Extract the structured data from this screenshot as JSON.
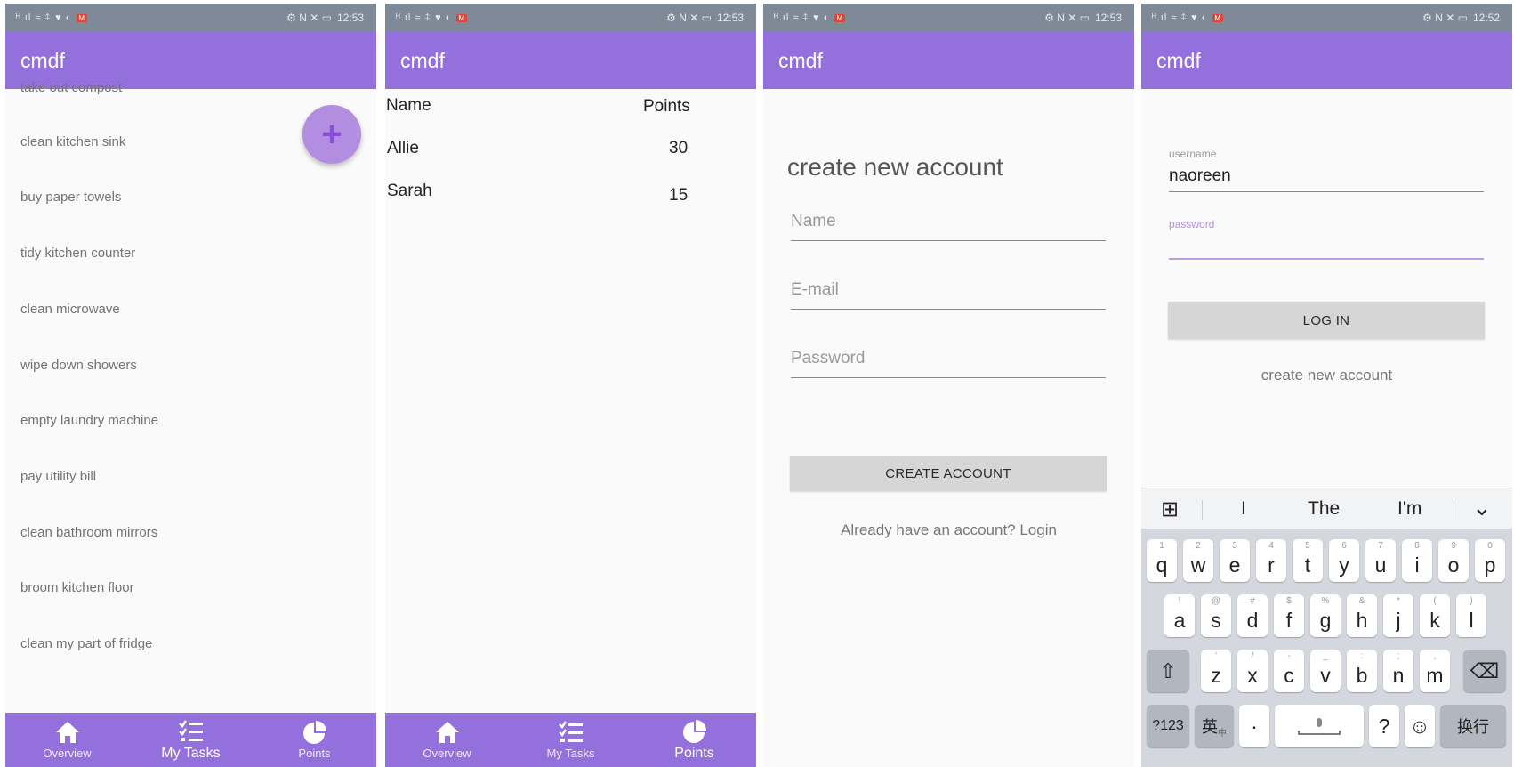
{
  "status_bar": {
    "left_icons": "ᴴ.ıl ≈ ⍏ ♥ ◐",
    "badge": "M",
    "right_icons": "⚙ N ✕ ▭",
    "times": [
      "12:53",
      "12:53",
      "12:53",
      "12:52"
    ]
  },
  "app": {
    "title": "cmdf"
  },
  "tasks": {
    "items": [
      "take out compost",
      "clean kitchen sink",
      "buy paper towels",
      "tidy kitchen counter",
      "clean microwave",
      "wipe down showers",
      "empty laundry machine",
      "pay utility bill",
      "clean bathroom mirrors",
      "broom kitchen floor",
      "clean my part of fridge"
    ],
    "fab_label": "+"
  },
  "points": {
    "headers": {
      "name": "Name",
      "points": "Points"
    },
    "rows": [
      {
        "name": "Allie",
        "points": "30"
      },
      {
        "name": "Sarah",
        "points": "15"
      }
    ]
  },
  "nav": {
    "overview": "Overview",
    "my_tasks": "My Tasks",
    "points": "Points"
  },
  "signup": {
    "heading": "create new account",
    "name_placeholder": "Name",
    "email_placeholder": "E-mail",
    "password_placeholder": "Password",
    "button": "CREATE ACCOUNT",
    "login_link": "Already have an account? Login"
  },
  "login": {
    "username_label": "username",
    "username_value": "naoreen",
    "password_label": "password",
    "password_value": "",
    "button": "LOG IN",
    "create_link": "create new account"
  },
  "keyboard": {
    "suggestions": [
      "I",
      "The",
      "I'm"
    ],
    "row1": [
      {
        "k": "q",
        "h": "1"
      },
      {
        "k": "w",
        "h": "2"
      },
      {
        "k": "e",
        "h": "3"
      },
      {
        "k": "r",
        "h": "4"
      },
      {
        "k": "t",
        "h": "5"
      },
      {
        "k": "y",
        "h": "6"
      },
      {
        "k": "u",
        "h": "7"
      },
      {
        "k": "i",
        "h": "8"
      },
      {
        "k": "o",
        "h": "9"
      },
      {
        "k": "p",
        "h": "0"
      }
    ],
    "row2": [
      {
        "k": "a",
        "h": "!"
      },
      {
        "k": "s",
        "h": "@"
      },
      {
        "k": "d",
        "h": "#"
      },
      {
        "k": "f",
        "h": "$"
      },
      {
        "k": "g",
        "h": "%"
      },
      {
        "k": "h",
        "h": "&"
      },
      {
        "k": "j",
        "h": "*"
      },
      {
        "k": "k",
        "h": "("
      },
      {
        "k": "l",
        "h": ")"
      }
    ],
    "row3": [
      {
        "k": "z",
        "h": "'"
      },
      {
        "k": "x",
        "h": "/"
      },
      {
        "k": "c",
        "h": "-"
      },
      {
        "k": "v",
        "h": "_"
      },
      {
        "k": "b",
        "h": ":"
      },
      {
        "k": "n",
        "h": ";"
      },
      {
        "k": "m",
        "h": ","
      }
    ],
    "shift": "⇧",
    "backspace": "⌫",
    "num": "?123",
    "lang": "英",
    "lang_sub": "中",
    "dot": "·",
    "question": "?",
    "emoji": "☺",
    "enter": "换行",
    "grid_icon": "⊞",
    "collapse_icon": "⌄"
  }
}
